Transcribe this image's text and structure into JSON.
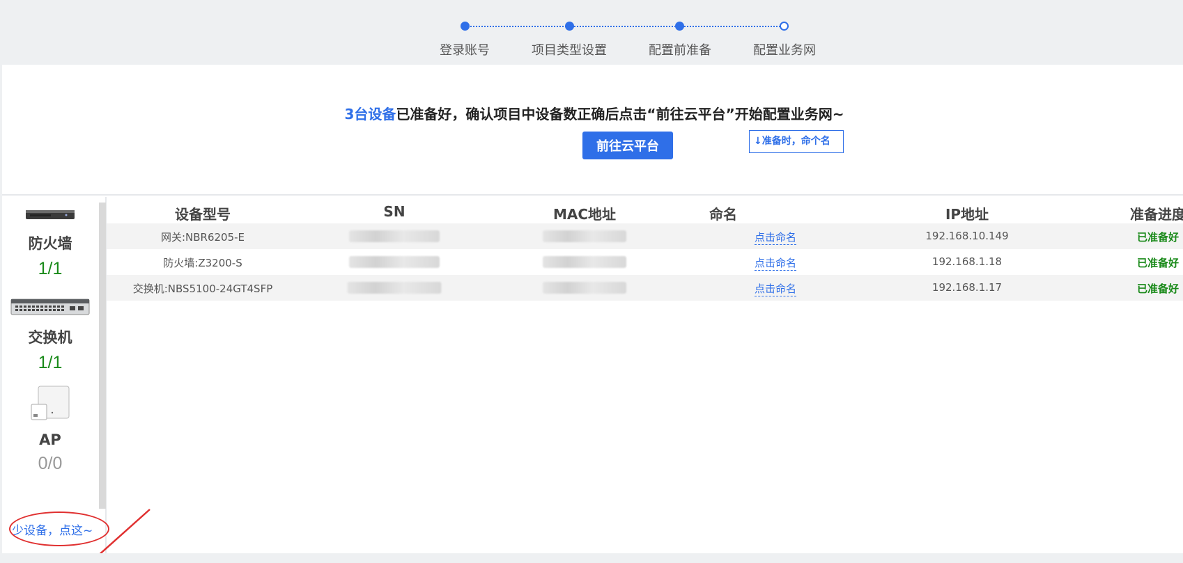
{
  "stepper": {
    "steps": [
      {
        "label": "登录账号",
        "state": "done"
      },
      {
        "label": "项目类型设置",
        "state": "done"
      },
      {
        "label": "配置前准备",
        "state": "current"
      },
      {
        "label": "配置业务网",
        "state": "todo"
      }
    ]
  },
  "banner": {
    "highlight": "3台设备",
    "message": "已准备好，确认项目中设备数正确后点击“前往云平台”开始配置业务网~",
    "button_label": "前往云平台"
  },
  "sidebar": {
    "devices": [
      {
        "name": "防火墙",
        "count": "1/1",
        "icon": "firewall-device-icon"
      },
      {
        "name": "交换机",
        "count": "1/1",
        "icon": "switch-device-icon"
      },
      {
        "name": "AP",
        "count": "0/0",
        "icon": "ap-device-icon"
      }
    ],
    "more_link": "少设备，点这~"
  },
  "table": {
    "headers": {
      "model": "设备型号",
      "sn": "SN",
      "mac": "MAC地址",
      "name": "命名",
      "ip": "IP地址",
      "progress": "准备进度"
    },
    "hint": "↓准备时，命个名",
    "rows": [
      {
        "model": "网关:NBR6205-E",
        "name_action": "点击命名",
        "ip": "192.168.10.149",
        "progress": "已准备好"
      },
      {
        "model": "防火墙:Z3200-S",
        "name_action": "点击命名",
        "ip": "192.168.1.18",
        "progress": "已准备好"
      },
      {
        "model": "交换机:NBS5100-24GT4SFP",
        "name_action": "点击命名",
        "ip": "192.168.1.17",
        "progress": "已准备好"
      }
    ]
  },
  "colors": {
    "accent": "#2f6fe8",
    "success": "#1a8a1a",
    "annotation": "#e03030"
  }
}
